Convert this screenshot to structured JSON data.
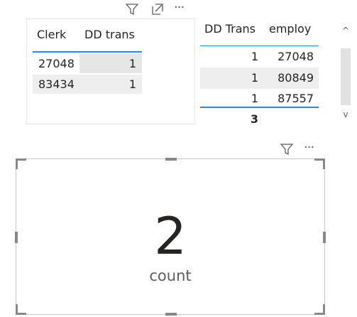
{
  "clerk_table": {
    "columns": [
      "Clerk",
      "DD trans"
    ],
    "rows": [
      [
        "27048",
        "1"
      ],
      [
        "83434",
        "1"
      ]
    ]
  },
  "dd_table": {
    "columns": [
      "DD Trans",
      "employ"
    ],
    "rows": [
      [
        "1",
        "27048"
      ],
      [
        "1",
        "80849"
      ],
      [
        "1",
        "87557"
      ]
    ],
    "total": "3",
    "scroll_up": "^",
    "scroll_down": "v"
  },
  "card": {
    "value": "2",
    "label": "count"
  },
  "icons": {
    "filter": "filter-icon",
    "focus": "focus-mode-icon",
    "more": "more-options-icon"
  },
  "more_glyph": "···",
  "colors": {
    "accent": "#118dff",
    "row_shade": "#eeeeee",
    "border": "#c8c6c4"
  }
}
